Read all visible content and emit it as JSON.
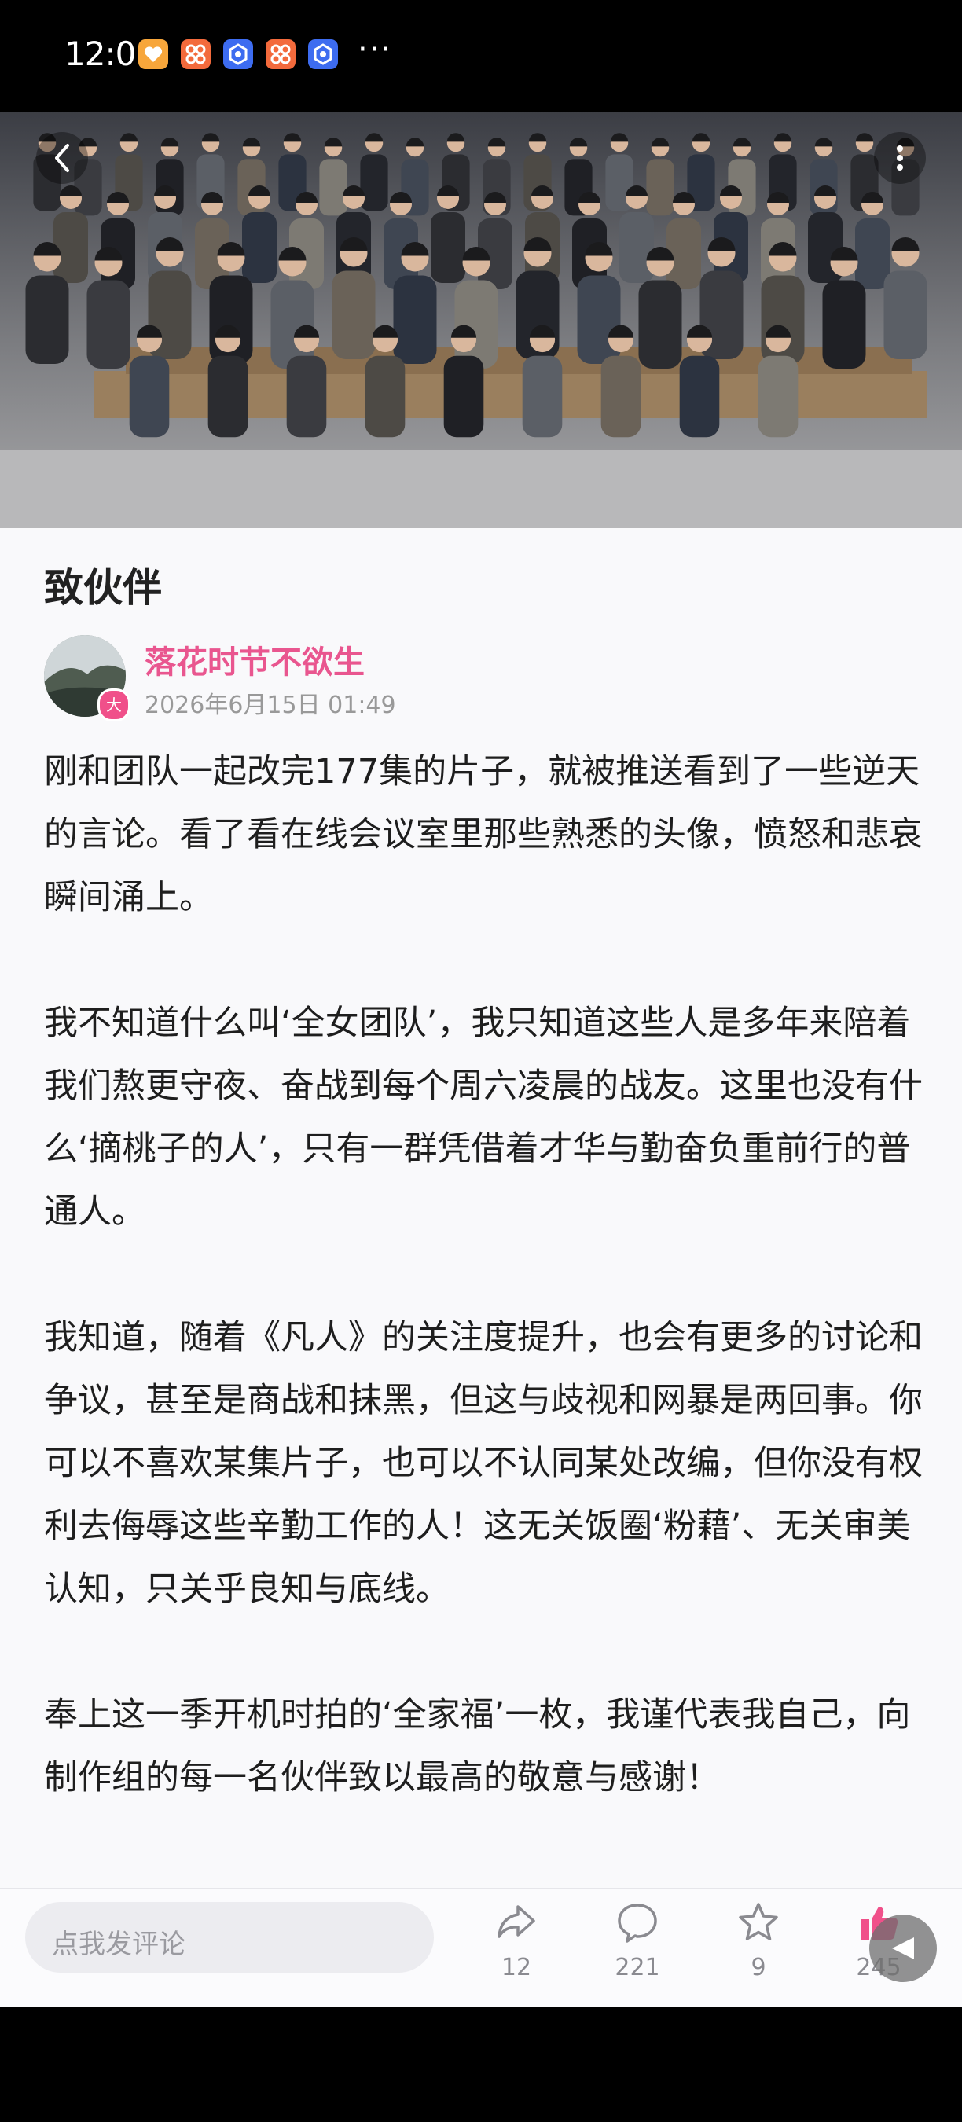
{
  "status_bar": {
    "time": "12:06",
    "app_icons": [
      "heart-app-icon",
      "grid-app-icon",
      "flower-app-icon",
      "grid-app-icon",
      "flower-app-icon"
    ],
    "overflow": "···"
  },
  "header": {
    "back_icon": "chevron-left-icon",
    "menu_icon": "vertical-dots-icon"
  },
  "post": {
    "title": "致伙伴",
    "author": "落花时节不欲生",
    "badge": "大",
    "date": "2026年6月15日 01:49",
    "paragraphs": [
      "刚和团队一起改完177集的片子，就被推送看到了一些逆天的言论。看了看在线会议室里那些熟悉的头像，愤怒和悲哀瞬间涌上。",
      "我不知道什么叫‘全女团队’，我只知道这些人是多年来陪着我们熬更守夜、奋战到每个周六凌晨的战友。这里也没有什么‘摘桃子的人’，只有一群凭借着才华与勤奋负重前行的普通人。",
      "我知道，随着《凡人》的关注度提升，也会有更多的讨论和争议，甚至是商战和抹黑，但这与歧视和网暴是两回事。你可以不喜欢某集片子，也可以不认同某处改编，但你没有权利去侮辱这些辛勤工作的人！这无关饭圈‘粉藉’、无关审美认知，只关乎良知与底线。",
      "奉上这一季开机时拍的‘全家福’一枚，我谨代表我自己，向制作组的每一名伙伴致以最高的敬意与感谢！"
    ]
  },
  "bottom_bar": {
    "comment_placeholder": "点我发评论",
    "share_count": "12",
    "comment_count": "221",
    "favorite_count": "9",
    "like_count": "245"
  },
  "colors": {
    "author": "#e9568f",
    "like": "#f0508a",
    "background": "#f9f9fb"
  }
}
